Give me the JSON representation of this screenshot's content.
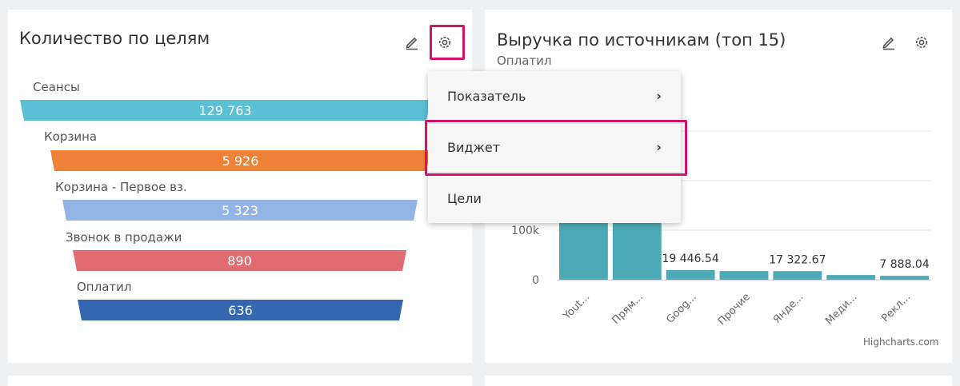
{
  "left_card": {
    "title": "Количество по целям",
    "edit_icon": "pencil-icon",
    "settings_icon": "gear-icon",
    "funnel": [
      {
        "label": "Сеансы",
        "value": "129 763",
        "color": "#5bbfd6"
      },
      {
        "label": "Корзина",
        "value": "5 926",
        "color": "#ef8236"
      },
      {
        "label": "Корзина - Первое вз.",
        "value": "5 323",
        "color": "#93b5e6"
      },
      {
        "label": "Звонок в продажи",
        "value": "890",
        "color": "#e06c72"
      },
      {
        "label": "Оплатил",
        "value": "636",
        "color": "#3467b0"
      }
    ]
  },
  "menu": {
    "items": [
      {
        "label": "Показатель",
        "chevron": "›"
      },
      {
        "label": "Виджет",
        "chevron": "›"
      },
      {
        "label": "Цели"
      }
    ]
  },
  "right_card": {
    "title": "Выручка по источникам (топ 15)",
    "subtitle": "Оплатил",
    "edit_icon": "pencil-icon",
    "settings_icon": "gear-icon",
    "credit": "Highcharts.com"
  },
  "chart_data": {
    "type": "bar",
    "categories": [
      "Yout...",
      "Прям...",
      "Goog...",
      "Прочие",
      "Янде...",
      "Меди...",
      "Рекл..."
    ],
    "values": [
      350000,
      350000,
      19446.54,
      17500,
      17322.67,
      9500,
      7888.04
    ],
    "data_labels": [
      "",
      "",
      "19 446.54",
      "",
      "17 322.67",
      "",
      "7 888.04"
    ],
    "y_ticks": [
      {
        "value": 0,
        "label": "0"
      },
      {
        "value": 100000,
        "label": "100k"
      }
    ],
    "ylim": [
      0,
      400000
    ],
    "color": "#4baab5",
    "grid": true
  }
}
